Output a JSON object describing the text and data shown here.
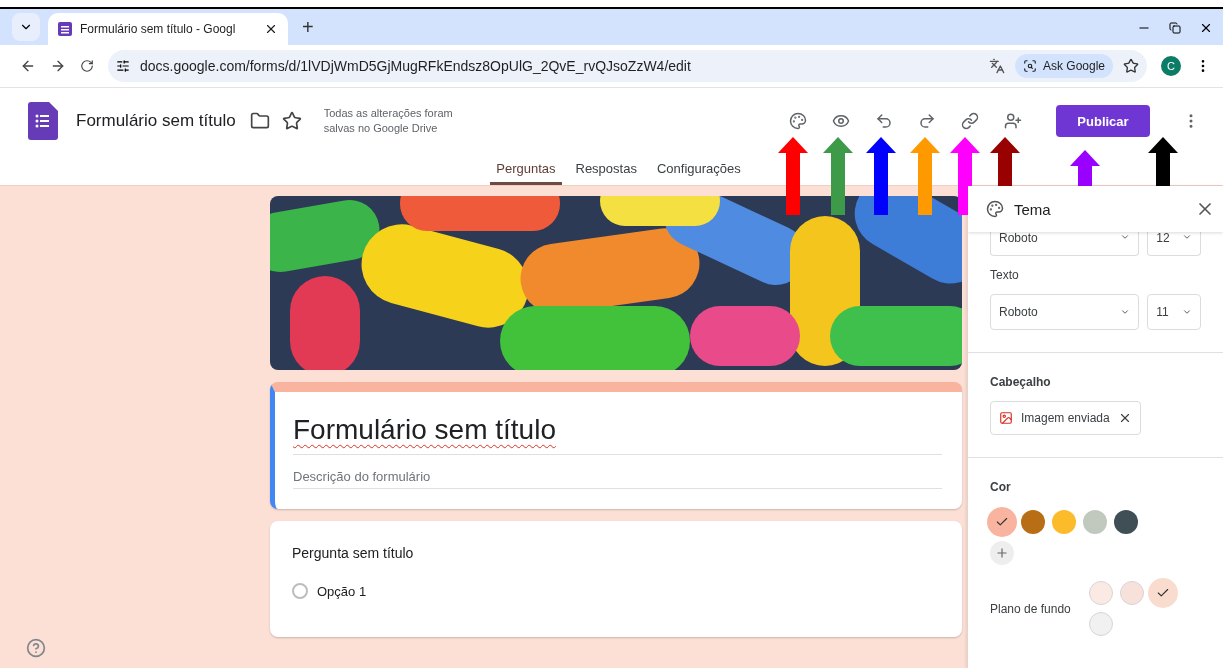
{
  "browser": {
    "tab_title": "Formulário sem título - Googl",
    "new_tab": "+",
    "url": "docs.google.com/forms/d/1lVDjWmD5GjMugRFkEndsz8OpUlG_2QvE_rvQJsoZzW4/edit",
    "ask_google": "Ask Google",
    "profile": "C"
  },
  "header": {
    "title": "Formulário sem título",
    "save_status": "Todas as alterações foram salvas no Google Drive",
    "publish_button": "Publicar"
  },
  "tabs": [
    {
      "label": "Perguntas",
      "selected": true
    },
    {
      "label": "Respostas",
      "selected": false
    },
    {
      "label": "Configurações",
      "selected": false
    }
  ],
  "form": {
    "title": "Formulário sem título",
    "description_placeholder": "Descrição do formulário",
    "question": {
      "title": "Pergunta sem título",
      "options": [
        {
          "label": "Opção 1",
          "selected": false
        }
      ]
    }
  },
  "theme_panel": {
    "title": "Tema",
    "header_font": {
      "font": "Roboto",
      "size": "12"
    },
    "text_label": "Texto",
    "text_font": {
      "font": "Roboto",
      "size": "11"
    },
    "header_section": "Cabeçalho",
    "header_image_chip": "Imagem enviada",
    "color_label": "Cor",
    "colors": [
      {
        "color": "#f9b4a0",
        "selected": true
      },
      {
        "color": "#b86e14",
        "selected": false
      },
      {
        "color": "#fbbb2b",
        "selected": false
      },
      {
        "color": "#c1c9bf",
        "selected": false
      },
      {
        "color": "#3f4f55",
        "selected": false
      }
    ],
    "background_label": "Plano de fundo",
    "backgrounds": [
      {
        "color": "#fbe9e4",
        "selected": false
      },
      {
        "color": "#f8e1da",
        "selected": false
      },
      {
        "color": "#fadccf",
        "selected": true
      },
      {
        "color": "#f1f1f1",
        "selected": false
      }
    ]
  },
  "annotations": [
    {
      "color": "#ff0000"
    },
    {
      "color": "#3c9a48"
    },
    {
      "color": "#0000ff"
    },
    {
      "color": "#ff9900"
    },
    {
      "color": "#ff00ff"
    },
    {
      "color": "#990000"
    },
    {
      "color": "#9900ff"
    },
    {
      "color": "#000000"
    }
  ]
}
